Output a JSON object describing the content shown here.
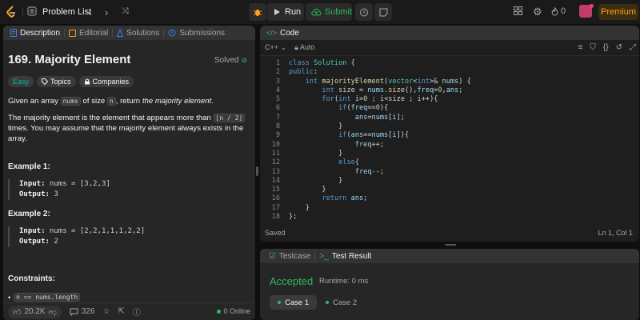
{
  "header": {
    "problem_list": "Problem List",
    "run": "Run",
    "submit": "Submit",
    "streak": "0",
    "premium": "Premium"
  },
  "left_tabs": [
    "Description",
    "Editorial",
    "Solutions",
    "Submissions"
  ],
  "problem": {
    "title": "169. Majority Element",
    "status": "Solved",
    "tags": [
      "Easy",
      "Topics",
      "Companies"
    ],
    "desc_1_a": "Given an array ",
    "desc_1_code": "nums",
    "desc_1_b": " of size ",
    "desc_1_code2": "n",
    "desc_1_c": ", return ",
    "desc_1_em": "the majority element",
    "desc_1_d": ".",
    "desc_2_a": "The majority element is the element that appears more than ",
    "desc_2_code": "⌊n / 2⌋",
    "desc_2_b": " times. You may assume that the majority element always exists in the array.",
    "ex1_title": "Example 1:",
    "ex1_input_label": "Input:",
    "ex1_input": " nums = [3,2,3]",
    "ex1_output_label": "Output:",
    "ex1_output": " 3",
    "ex2_title": "Example 2:",
    "ex2_input_label": "Input:",
    "ex2_input": " nums = [2,2,1,1,1,2,2]",
    "ex2_output_label": "Output:",
    "ex2_output": " 2",
    "constraints_title": "Constraints:",
    "constraint_1": "n == nums.length"
  },
  "left_footer": {
    "likes": "20.2K",
    "comments": "326",
    "online": "0 Online"
  },
  "code_panel": {
    "title": "Code",
    "language": "C++",
    "mode": "Auto",
    "status": "Saved",
    "cursor": "Ln 1, Col 1",
    "lines": [
      "class Solution {",
      "public:",
      "    int majorityElement(vector<int>& nums) {",
      "        int size = nums.size(),freq=0,ans;",
      "        for(int i=0 ; i<size ; i++){",
      "            if(freq==0){",
      "                ans=nums[i];",
      "            }",
      "            if(ans==nums[i]){",
      "                freq++;",
      "            }",
      "            else{",
      "                freq--;",
      "            }",
      "        }",
      "        return ans;",
      "    }",
      "};"
    ]
  },
  "test_panel": {
    "tabs": [
      "Testcase",
      "Test Result"
    ],
    "result": "Accepted",
    "runtime": "Runtime: 0 ms",
    "cases": [
      "Case 1",
      "Case 2"
    ]
  }
}
